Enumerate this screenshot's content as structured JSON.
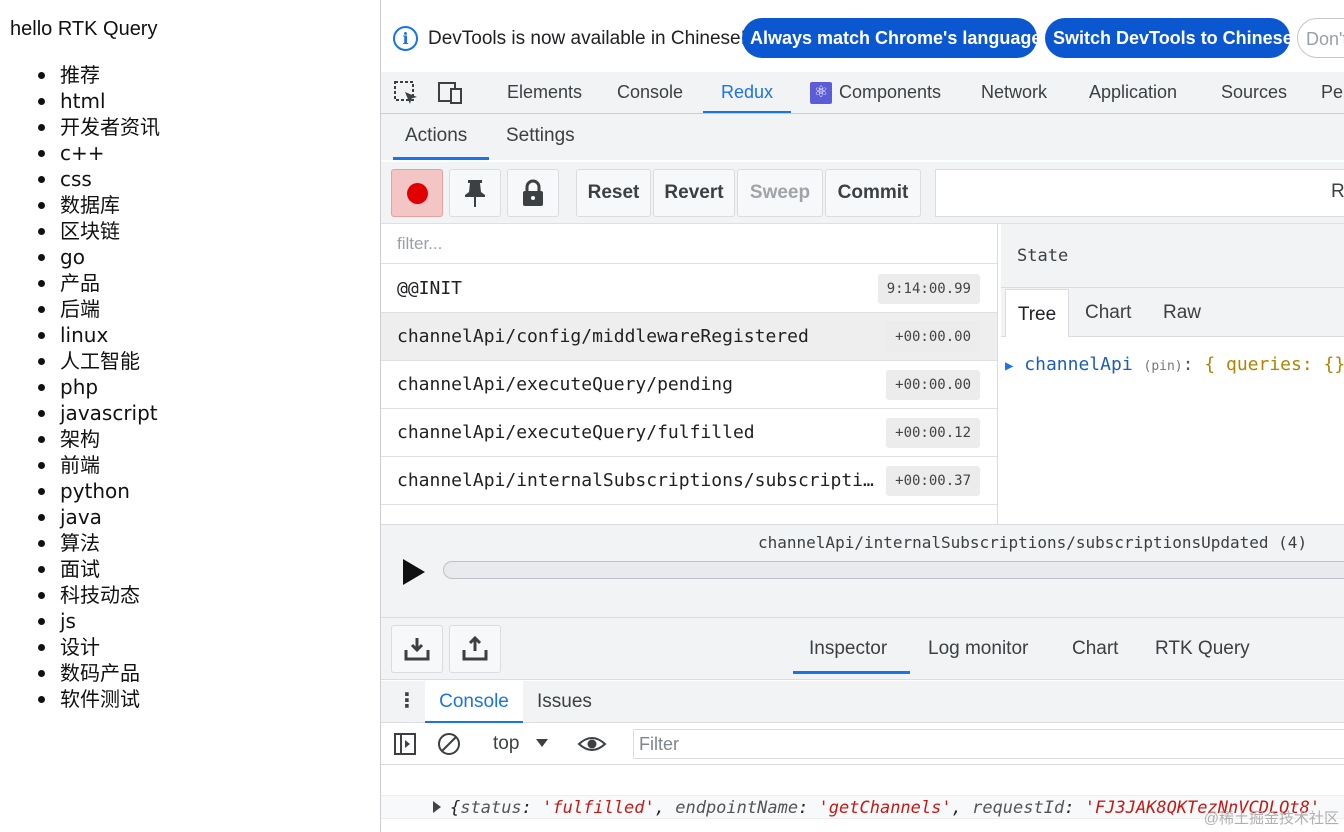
{
  "page": {
    "title": "hello RTK Query",
    "channels": [
      "推荐",
      "html",
      "开发者资讯",
      "c++",
      "css",
      "数据库",
      "区块链",
      "go",
      "产品",
      "后端",
      "linux",
      "人工智能",
      "php",
      "javascript",
      "架构",
      "前端",
      "python",
      "java",
      "算法",
      "面试",
      "科技动态",
      "js",
      "设计",
      "数码产品",
      "软件测试"
    ]
  },
  "infobar": {
    "message": "DevTools is now available in Chinese!",
    "match_label": "Always match Chrome's language",
    "switch_label": "Switch DevTools to Chinese",
    "dont_label": "Don't"
  },
  "main_tabs": {
    "elements": "Elements",
    "console": "Console",
    "redux": "Redux",
    "components": "Components",
    "network": "Network",
    "application": "Application",
    "sources": "Sources",
    "perf": "Per"
  },
  "redux": {
    "subtabs": {
      "actions": "Actions",
      "settings": "Settings"
    },
    "toolbar": {
      "reset": "Reset",
      "revert": "Revert",
      "sweep": "Sweep",
      "commit": "Commit",
      "right_text": "R"
    },
    "filter_placeholder": "filter...",
    "actions": [
      {
        "name": "@@INIT",
        "time": "9:14:00.99"
      },
      {
        "name": "channelApi/config/middlewareRegistered",
        "time": "+00:00.00"
      },
      {
        "name": "channelApi/executeQuery/pending",
        "time": "+00:00.00"
      },
      {
        "name": "channelApi/executeQuery/fulfilled",
        "time": "+00:00.12"
      },
      {
        "name": "channelApi/internalSubscriptions/subscriptionsUpdated",
        "time": "+00:00.37"
      }
    ],
    "state": {
      "title": "State",
      "tabs": {
        "tree": "Tree",
        "chart": "Chart",
        "raw": "Raw"
      },
      "tree_key": "channelApi",
      "tree_pin": "(pin)",
      "tree_colon": ":",
      "tree_value": "{ queries: {}"
    },
    "slider_label": "channelApi/internalSubscriptions/subscriptionsUpdated (4)",
    "monitor_tabs": {
      "inspector": "Inspector",
      "log_monitor": "Log monitor",
      "chart": "Chart",
      "rtk_query": "RTK Query"
    }
  },
  "drawer": {
    "menu_glyph": "⋮",
    "tabs": {
      "console": "Console",
      "issues": "Issues"
    },
    "context": "top",
    "filter_placeholder": "Filter"
  },
  "console_log": {
    "open": "{",
    "k1": "status",
    "v1": "'fulfilled'",
    "k2": "endpointName",
    "v2": "'getChannels'",
    "k3": "requestId",
    "v3": "'FJ3JAK8QKTezNnVCDLQt8'",
    "sep": ": ",
    "comma": ", "
  },
  "watermark": "@稀土掘金技术社区",
  "colors": {
    "accent": "#1a73e8",
    "button_blue": "#0b57d0",
    "record_red": "#e00000"
  }
}
